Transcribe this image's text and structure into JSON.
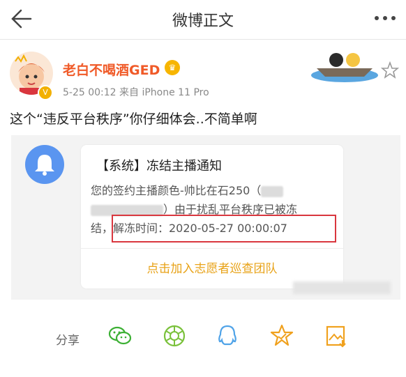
{
  "header": {
    "title": "微博正文"
  },
  "post": {
    "username": "老白不喝酒GED",
    "meta": "5-25 00:12  来自 iPhone 11 Pro",
    "text": "这个“违反平台秩序”你仔细体会..不简单啊"
  },
  "notice": {
    "title": "【系统】冻结主播通知",
    "body_line1_prefix": "您的签约主播颜色-帅比在石250（",
    "body_line2_suffix": "）由于扰乱平台秩序已被冻",
    "body_line3": "结，解冻时间：2020-05-27 00:00:07",
    "action": "点击加入志愿者巡查团队"
  },
  "share": {
    "label": "分享"
  },
  "colors": {
    "username": "#f05a28",
    "action": "#e8a217",
    "highlight": "#d9363e",
    "wechat": "#3cb034",
    "moments": "#7ac13b",
    "qq": "#4fa3e8",
    "star": "#f0a11e"
  },
  "icons": [
    "back-arrow-icon",
    "more-icon",
    "favorite-star-icon",
    "bell-icon",
    "wechat-icon",
    "moments-icon",
    "qq-icon",
    "star-icon",
    "image-save-icon"
  ]
}
